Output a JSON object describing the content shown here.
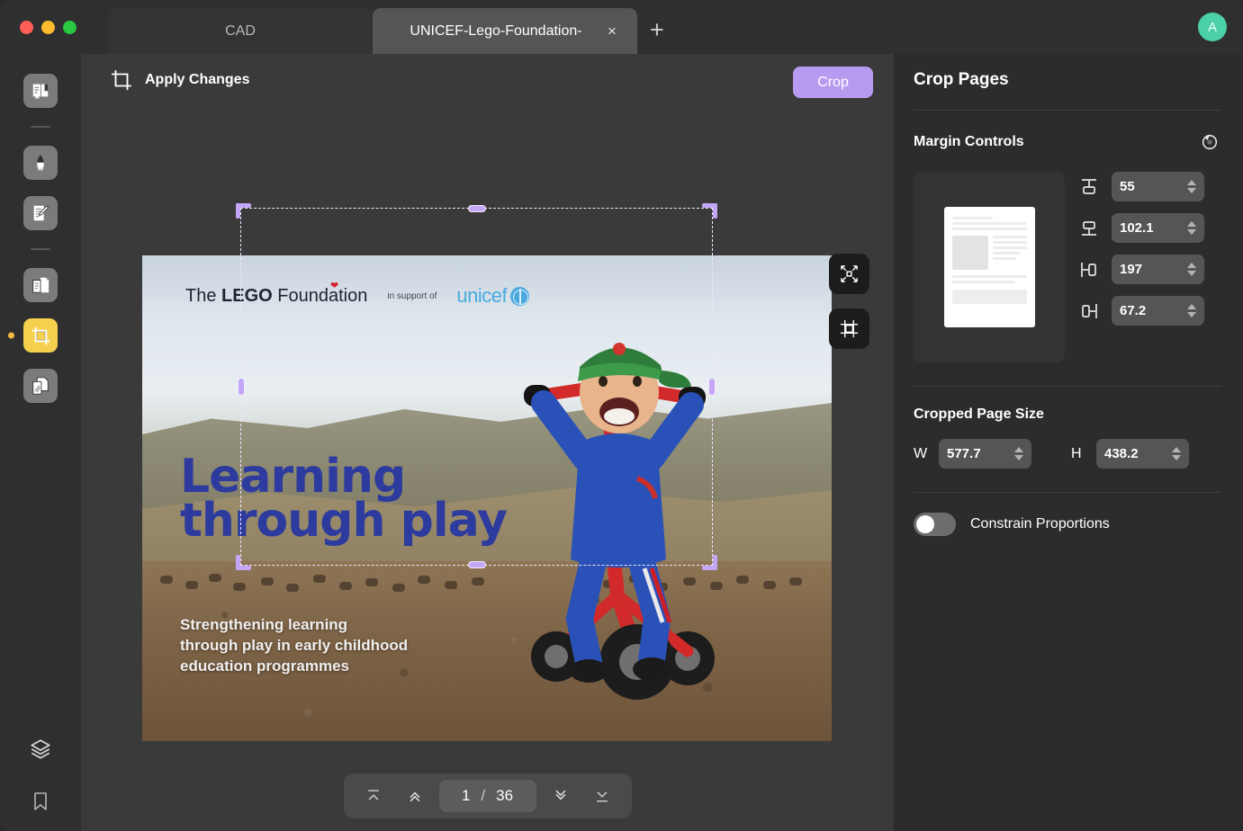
{
  "window": {
    "traffic_lights": [
      "close",
      "minimize",
      "zoom"
    ],
    "new_tab_label": "+",
    "avatar_initial": "A"
  },
  "tabs": [
    {
      "label": "CAD",
      "active": false
    },
    {
      "label": "UNICEF-Lego-Foundation-",
      "active": true,
      "close_label": "×"
    }
  ],
  "sidebar": {
    "items": [
      {
        "name": "read-mode",
        "icon": "book-icon",
        "active": false
      },
      {
        "name": "highlight",
        "icon": "highlighter-icon",
        "active": false
      },
      {
        "name": "annotate",
        "icon": "edit-document-icon",
        "active": false
      },
      {
        "name": "organize-pages",
        "icon": "pages-icon",
        "active": false
      },
      {
        "name": "crop-pages",
        "icon": "crop-icon",
        "active": true
      },
      {
        "name": "compare",
        "icon": "compare-documents-icon",
        "active": false
      }
    ],
    "bottom_items": [
      {
        "name": "layers",
        "icon": "layers-icon"
      },
      {
        "name": "bookmarks",
        "icon": "bookmark-icon"
      }
    ]
  },
  "toolbar": {
    "apply_label": "Apply Changes",
    "apply_icon": "crop-apply-icon",
    "crop_label": "Crop",
    "crop_color": "#b79bf0"
  },
  "canvas": {
    "float_buttons": [
      {
        "name": "fit-to-screen",
        "icon": "expand-arrows-icon"
      },
      {
        "name": "crop-marks",
        "icon": "crop-frame-icon"
      }
    ],
    "document_page": {
      "brand_line": "The LEGO Foundation",
      "brand_prefix": "The ",
      "brand_bold": "LEGO",
      "brand_suffix": " Foundation",
      "support_text": "in support of",
      "partner_logo": "unicef",
      "headline_line1": "Learning",
      "headline_line2": "through play",
      "headline_color": "#2d3b9e",
      "subhead_line1": "Strengthening learning",
      "subhead_line2": "through play in early childhood",
      "subhead_line3": "education programmes"
    },
    "selection": {
      "handle_color": "#c3a6f5",
      "border_style": "dashed-white"
    }
  },
  "pager": {
    "first_label": "first-page",
    "prev_label": "previous-page",
    "current_page": "1",
    "separator": "/",
    "total_pages": "36",
    "next_label": "next-page",
    "last_label": "last-page"
  },
  "panel": {
    "title": "Crop Pages",
    "margin_section": {
      "title": "Margin Controls",
      "reset_icon": "reset-icon",
      "fields": [
        {
          "name": "margin-top",
          "icon": "margin-top-icon",
          "value": "55"
        },
        {
          "name": "margin-bottom",
          "icon": "margin-bottom-icon",
          "value": "102.1"
        },
        {
          "name": "margin-left",
          "icon": "margin-left-icon",
          "value": "197"
        },
        {
          "name": "margin-right",
          "icon": "margin-right-icon",
          "value": "67.2"
        }
      ]
    },
    "size_section": {
      "title": "Cropped Page Size",
      "width_label": "W",
      "width_value": "577.7",
      "height_label": "H",
      "height_value": "438.2"
    },
    "constrain": {
      "label": "Constrain Proportions",
      "enabled": false
    }
  }
}
